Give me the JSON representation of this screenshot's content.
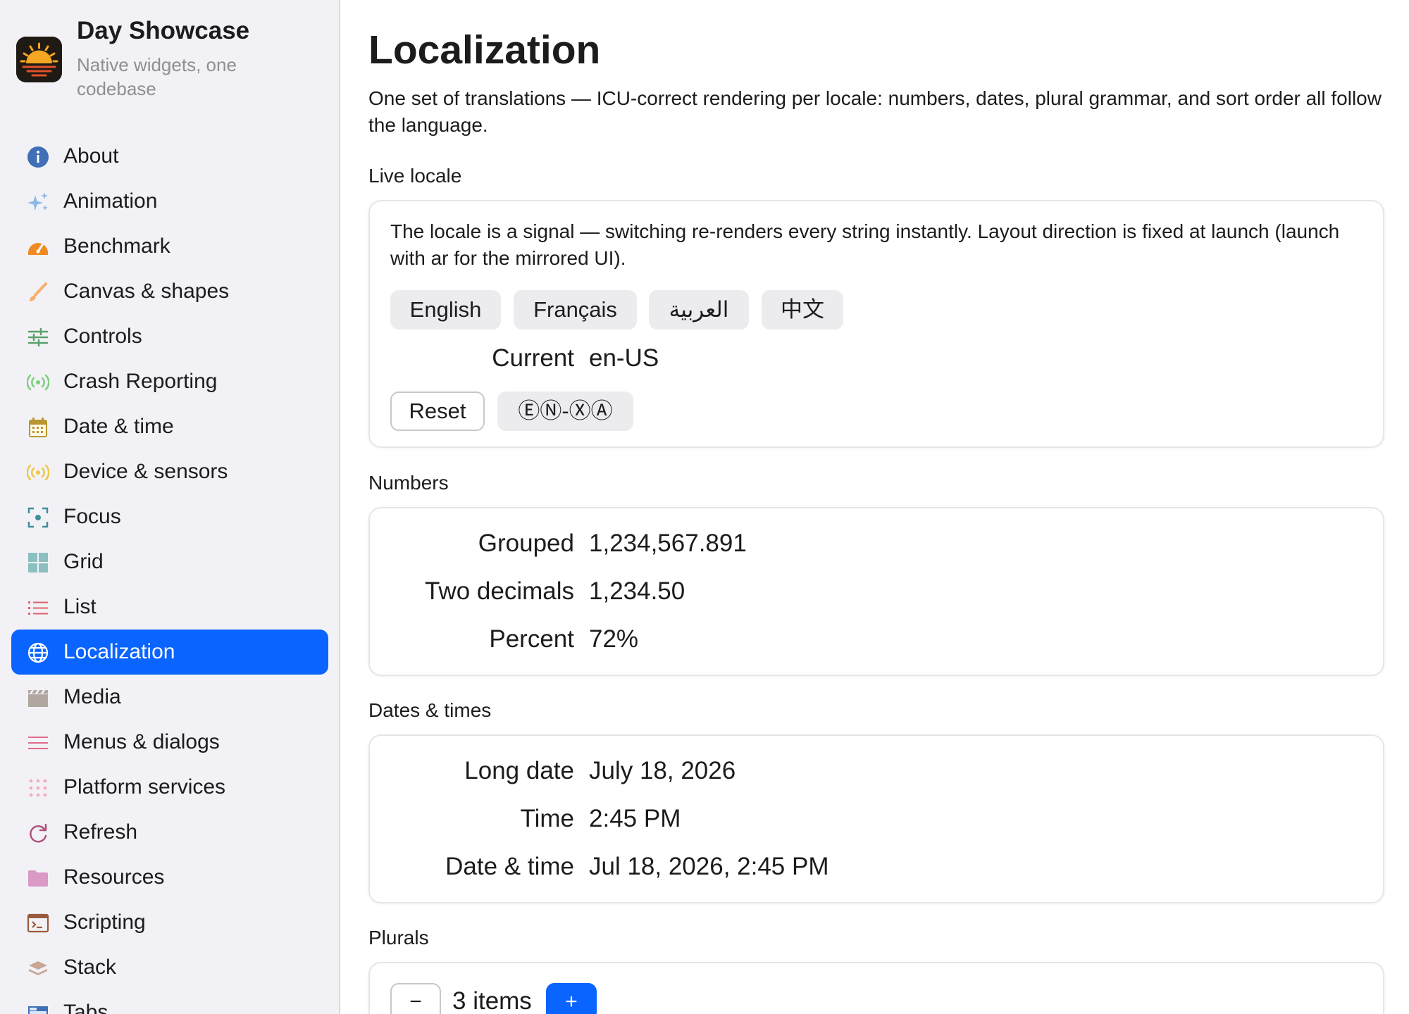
{
  "app": {
    "title": "Day Showcase",
    "subtitle": "Native widgets, one codebase",
    "logo_icon": "sunrise-icon"
  },
  "sidebar": {
    "items": [
      {
        "label": "About",
        "icon": "info-icon",
        "color": "#3f6fb5"
      },
      {
        "label": "Animation",
        "icon": "sparkles-icon",
        "color": "#8fb8e8"
      },
      {
        "label": "Benchmark",
        "icon": "speedometer-icon",
        "color": "#f08a24"
      },
      {
        "label": "Canvas & shapes",
        "icon": "paintbrush-icon",
        "color": "#f5b06a"
      },
      {
        "label": "Controls",
        "icon": "sliders-icon",
        "color": "#5aa06a"
      },
      {
        "label": "Crash Reporting",
        "icon": "broadcast-icon",
        "color": "#7ccf7c"
      },
      {
        "label": "Date & time",
        "icon": "calendar-icon",
        "color": "#b8962e"
      },
      {
        "label": "Device & sensors",
        "icon": "broadcast-icon",
        "color": "#f0c64a"
      },
      {
        "label": "Focus",
        "icon": "focus-icon",
        "color": "#3f8f99"
      },
      {
        "label": "Grid",
        "icon": "grid-icon",
        "color": "#8cbfbf"
      },
      {
        "label": "List",
        "icon": "list-icon",
        "color": "#e0606a"
      },
      {
        "label": "Localization",
        "icon": "globe-icon",
        "color": "#ffffff",
        "active": true
      },
      {
        "label": "Media",
        "icon": "clapperboard-icon",
        "color": "#b0a8a0"
      },
      {
        "label": "Menus & dialogs",
        "icon": "menu-icon",
        "color": "#e26a8c"
      },
      {
        "label": "Platform services",
        "icon": "dots-grid-icon",
        "color": "#f2a7c0"
      },
      {
        "label": "Refresh",
        "icon": "refresh-icon",
        "color": "#b0527a"
      },
      {
        "label": "Resources",
        "icon": "folder-icon",
        "color": "#d99ac6"
      },
      {
        "label": "Scripting",
        "icon": "terminal-icon",
        "color": "#9a5b3c"
      },
      {
        "label": "Stack",
        "icon": "layers-icon",
        "color": "#c9a693"
      },
      {
        "label": "Tabs",
        "icon": "tabs-icon",
        "color": "#3f6fb5"
      }
    ]
  },
  "main": {
    "title": "Localization",
    "description": "One set of translations — ICU-correct rendering per locale: numbers, dates, plural grammar, and sort order all follow the language.",
    "live_locale": {
      "label": "Live locale",
      "text": "The locale is a signal — switching re-renders every string instantly. Layout direction is fixed at launch (launch with ar for the mirrored UI).",
      "languages": [
        "English",
        "Français",
        "العربية",
        "中文"
      ],
      "current_key": "Current",
      "current_value": "en-US",
      "reset_label": "Reset",
      "pseudo_label": "ⒺⓃ-ⓍⒶ"
    },
    "numbers": {
      "label": "Numbers",
      "rows": [
        {
          "key": "Grouped",
          "value": "1,234,567.891"
        },
        {
          "key": "Two decimals",
          "value": "1,234.50"
        },
        {
          "key": "Percent",
          "value": "72%"
        }
      ]
    },
    "dates": {
      "label": "Dates & times",
      "rows": [
        {
          "key": "Long date",
          "value": "July 18, 2026"
        },
        {
          "key": "Time",
          "value": "2:45 PM"
        },
        {
          "key": "Date & time",
          "value": "Jul 18, 2026, 2:45 PM"
        }
      ]
    },
    "plurals": {
      "label": "Plurals",
      "minus_label": "−",
      "count_text": "3 items",
      "plus_label": "+"
    }
  },
  "colors": {
    "accent": "#0a64ff",
    "sidebar_bg": "#f2f2f6"
  }
}
